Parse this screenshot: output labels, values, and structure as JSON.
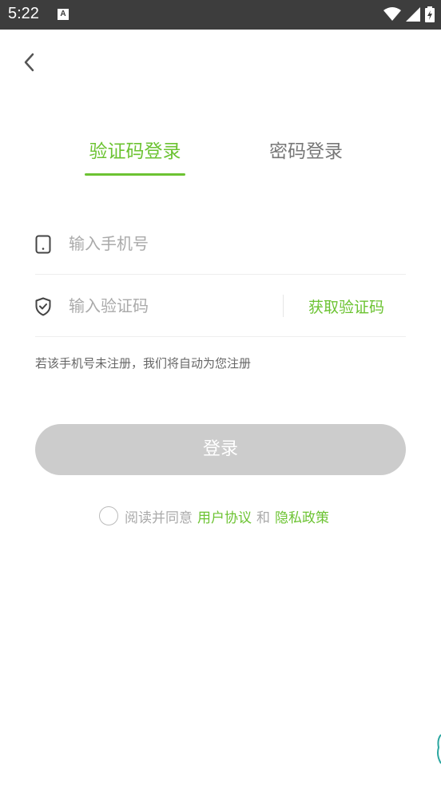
{
  "status_bar": {
    "time": "5:22",
    "notification": "A"
  },
  "tabs": [
    {
      "label": "验证码登录",
      "active": true
    },
    {
      "label": "密码登录",
      "active": false
    }
  ],
  "phone_field": {
    "placeholder": "输入手机号",
    "value": ""
  },
  "code_field": {
    "placeholder": "输入验证码",
    "value": ""
  },
  "get_code_label": "获取验证码",
  "hint": "若该手机号未注册，我们将自动为您注册",
  "login_label": "登录",
  "agreement": {
    "prefix": "阅读并同意",
    "user_agreement": "用户协议",
    "and": "和",
    "privacy_policy": "隐私政策"
  },
  "colors": {
    "accent": "#6cc332",
    "status_bar": "#3d3d3d",
    "button_disabled": "#cccccc"
  }
}
